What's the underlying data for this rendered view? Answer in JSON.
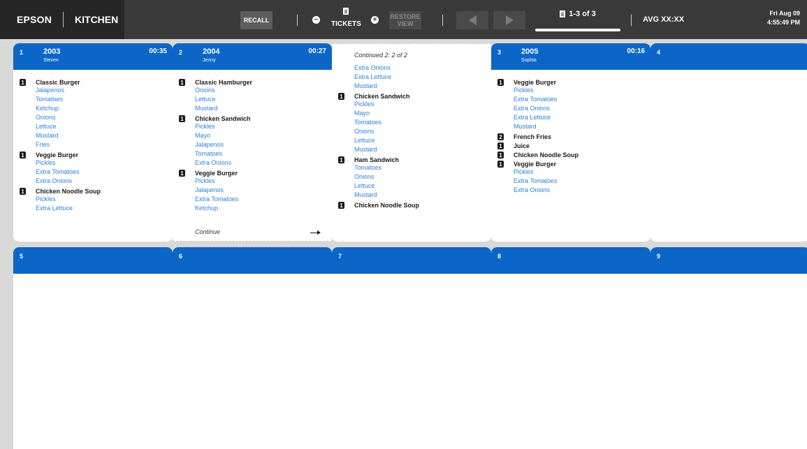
{
  "header": {
    "brand": "EPSON",
    "station": "KITCHEN",
    "recall_label": "RECALL",
    "tickets_label": "TICKETS",
    "minus_symbol": "−",
    "plus_symbol": "+",
    "restore_label": "RESTORE VIEW",
    "pager_text": "1-3 of 3",
    "avg_label": "AVG XX:XX",
    "date": "Fri Aug 09",
    "time": "4:55:49 PM"
  },
  "colors": {
    "accent": "#0b66c8",
    "modifier": "#2f80dd",
    "topbar": "#3a3a3a"
  },
  "tickets": [
    {
      "position": "1",
      "number": "2003",
      "server": "Steven",
      "elapsed": "00:35",
      "lines": [
        {
          "t": "item",
          "qty": "1",
          "name": "Classic Burger"
        },
        {
          "t": "mod",
          "name": "Jalapenos"
        },
        {
          "t": "mod",
          "name": "Tomatoes"
        },
        {
          "t": "mod",
          "name": "Ketchup"
        },
        {
          "t": "mod",
          "name": "Onions"
        },
        {
          "t": "mod",
          "name": "Lettuce"
        },
        {
          "t": "mod",
          "name": "Mustard"
        },
        {
          "t": "mod",
          "name": "Fries"
        },
        {
          "t": "item",
          "qty": "1",
          "name": "Veggie Burger"
        },
        {
          "t": "mod",
          "name": "Pickles"
        },
        {
          "t": "mod",
          "name": "Extra Tomatoes"
        },
        {
          "t": "mod",
          "name": "Extra Onions"
        },
        {
          "t": "item",
          "qty": "1",
          "name": "Chicken Noodle Soup"
        },
        {
          "t": "mod",
          "name": "Pickles"
        },
        {
          "t": "mod",
          "name": "Extra Lettuce"
        }
      ]
    },
    {
      "position": "2",
      "number": "2004",
      "server": "Jenny",
      "elapsed": "00:27",
      "continue_label": "Continue",
      "lines": [
        {
          "t": "item",
          "qty": "1",
          "name": "Classic Hamburger"
        },
        {
          "t": "mod",
          "name": "Onions"
        },
        {
          "t": "mod",
          "name": "Lettuce"
        },
        {
          "t": "mod",
          "name": "Mustard"
        },
        {
          "t": "item",
          "qty": "1",
          "name": "Chicken Sandwich"
        },
        {
          "t": "mod",
          "name": "Pickles"
        },
        {
          "t": "mod",
          "name": "Mayo"
        },
        {
          "t": "mod",
          "name": "Jalapenos"
        },
        {
          "t": "mod",
          "name": "Tomatoes"
        },
        {
          "t": "mod",
          "name": "Extra Onions"
        },
        {
          "t": "item",
          "qty": "1",
          "name": "Veggie Burger"
        },
        {
          "t": "mod",
          "name": "Pickles"
        },
        {
          "t": "mod",
          "name": "Jalapenos"
        },
        {
          "t": "mod",
          "name": "Extra Tomatoes"
        },
        {
          "t": "mod",
          "name": "Ketchup"
        }
      ]
    },
    {
      "continued_label": "Continued 2: 2 of 2",
      "lines": [
        {
          "t": "mod",
          "name": "Extra Onions"
        },
        {
          "t": "mod",
          "name": "Extra Lettuce"
        },
        {
          "t": "mod",
          "name": "Mustard"
        },
        {
          "t": "item",
          "qty": "1",
          "name": "Chicken Sandwich"
        },
        {
          "t": "mod",
          "name": "Pickles"
        },
        {
          "t": "mod",
          "name": "Mayo"
        },
        {
          "t": "mod",
          "name": "Tomatoes"
        },
        {
          "t": "mod",
          "name": "Onions"
        },
        {
          "t": "mod",
          "name": "Lettuce"
        },
        {
          "t": "mod",
          "name": "Mustard"
        },
        {
          "t": "item",
          "qty": "1",
          "name": "Ham Sandwich"
        },
        {
          "t": "mod",
          "name": "Tomatoes"
        },
        {
          "t": "mod",
          "name": "Onions"
        },
        {
          "t": "mod",
          "name": "Lettuce"
        },
        {
          "t": "mod",
          "name": "Mustard"
        },
        {
          "t": "item",
          "qty": "1",
          "name": "Chicken Noodle Soup"
        }
      ]
    },
    {
      "position": "3",
      "number": "2005",
      "server": "Sophia",
      "elapsed": "00:16",
      "lines": [
        {
          "t": "item",
          "qty": "1",
          "name": "Veggie Burger"
        },
        {
          "t": "mod",
          "name": "Pickles"
        },
        {
          "t": "mod",
          "name": "Extra Tomatoes"
        },
        {
          "t": "mod",
          "name": "Extra Onions"
        },
        {
          "t": "mod",
          "name": "Extra Lettuce"
        },
        {
          "t": "mod",
          "name": "Mustard"
        },
        {
          "t": "item",
          "qty": "2",
          "name": "French Fries"
        },
        {
          "t": "item",
          "qty": "1",
          "name": "Juice"
        },
        {
          "t": "item",
          "qty": "1",
          "name": "Chicken Noodle Soup"
        },
        {
          "t": "item",
          "qty": "1",
          "name": "Veggie Burger"
        },
        {
          "t": "mod",
          "name": "Pickles"
        },
        {
          "t": "mod",
          "name": "Extra Tomatoes"
        },
        {
          "t": "mod",
          "name": "Extra Onions"
        }
      ]
    }
  ],
  "empty_slots": [
    "4",
    "5",
    "6",
    "7",
    "8",
    "9"
  ]
}
